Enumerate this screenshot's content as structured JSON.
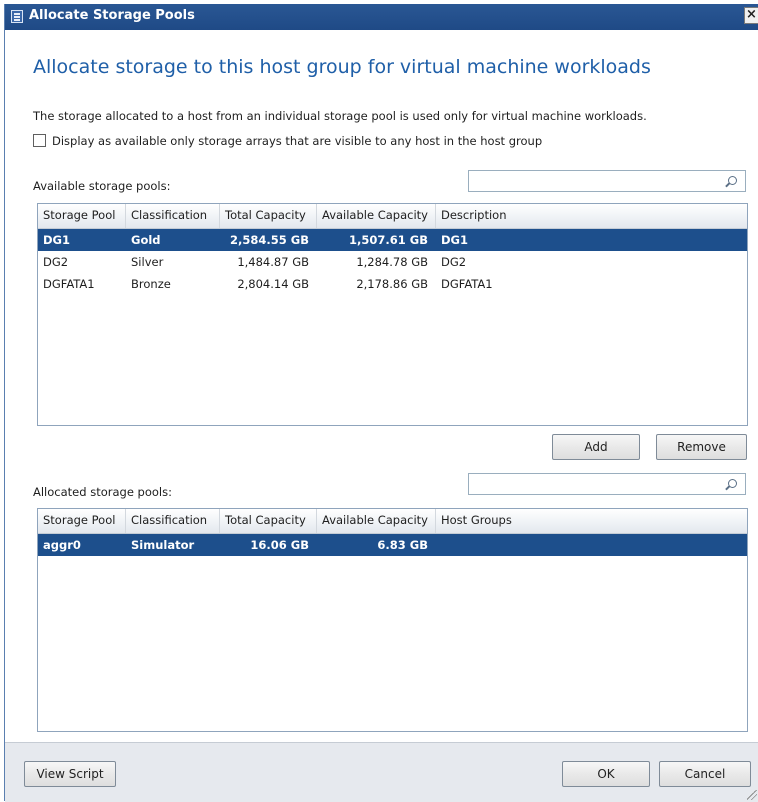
{
  "window": {
    "title": "Allocate Storage Pools",
    "close_glyph": "×"
  },
  "heading": "Allocate storage to this host group for virtual machine workloads",
  "description": "The storage allocated to a host from an individual storage pool is used only for virtual machine workloads.",
  "checkbox": {
    "checked": false,
    "label": "Display as available only storage arrays that are visible to any host in the host group"
  },
  "available": {
    "label": "Available storage pools:",
    "search_value": "",
    "columns": [
      "Storage Pool",
      "Classification",
      "Total Capacity",
      "Available Capacity",
      "Description"
    ],
    "rows": [
      {
        "pool": "DG1",
        "classification": "Gold",
        "total": "2,584.55 GB",
        "available": "1,507.61 GB",
        "description": "DG1",
        "selected": true
      },
      {
        "pool": "DG2",
        "classification": "Silver",
        "total": "1,484.87 GB",
        "available": "1,284.78 GB",
        "description": "DG2",
        "selected": false
      },
      {
        "pool": "DGFATA1",
        "classification": "Bronze",
        "total": "2,804.14 GB",
        "available": "2,178.86 GB",
        "description": "DGFATA1",
        "selected": false
      }
    ]
  },
  "buttons": {
    "add": "Add",
    "remove": "Remove",
    "view_script": "View Script",
    "ok": "OK",
    "cancel": "Cancel"
  },
  "allocated": {
    "label": "Allocated storage pools:",
    "search_value": "",
    "columns": [
      "Storage Pool",
      "Classification",
      "Total Capacity",
      "Available Capacity",
      "Host Groups"
    ],
    "rows": [
      {
        "pool": "aggr0",
        "classification": "Simulator",
        "total": "16.06 GB",
        "available": "6.83 GB",
        "host_groups": "",
        "selected": true
      }
    ]
  },
  "colors": {
    "title_bar": "#1f4a86",
    "heading": "#1f5fa8",
    "selection": "#1d4f8c"
  },
  "icons": {
    "window": "dialog-icon",
    "search": "search-icon",
    "close": "close-icon",
    "resize": "resize-grip-icon"
  }
}
